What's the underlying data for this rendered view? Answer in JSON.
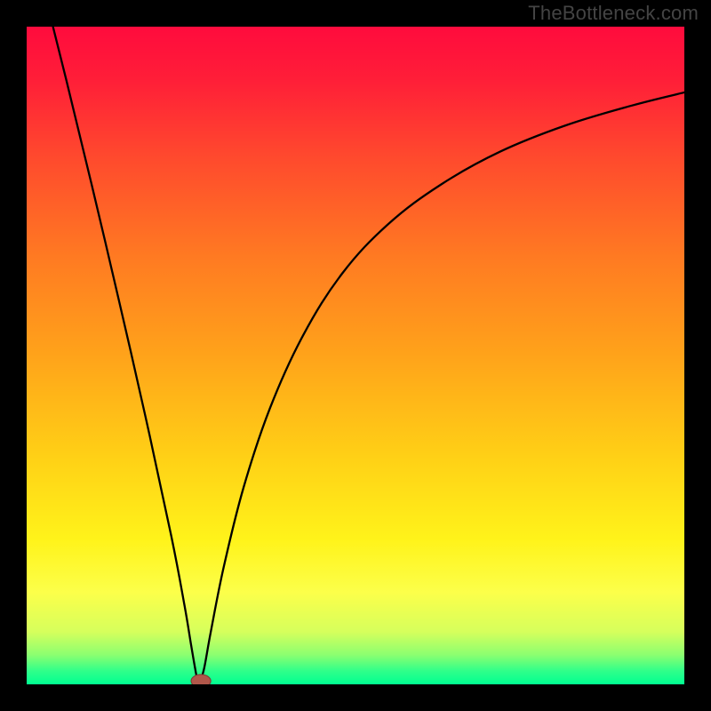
{
  "watermark": "TheBottleneck.com",
  "colors": {
    "page_bg": "#000000",
    "watermark_color": "#444444",
    "gradient_stops": [
      {
        "offset": 0.0,
        "color": "#ff0b3d"
      },
      {
        "offset": 0.08,
        "color": "#ff1e38"
      },
      {
        "offset": 0.2,
        "color": "#ff4a2d"
      },
      {
        "offset": 0.35,
        "color": "#ff7a22"
      },
      {
        "offset": 0.5,
        "color": "#ffa31a"
      },
      {
        "offset": 0.65,
        "color": "#ffcf16"
      },
      {
        "offset": 0.78,
        "color": "#fff31a"
      },
      {
        "offset": 0.86,
        "color": "#fcff4a"
      },
      {
        "offset": 0.92,
        "color": "#d6ff5c"
      },
      {
        "offset": 0.955,
        "color": "#8cff70"
      },
      {
        "offset": 0.98,
        "color": "#2fff8a"
      },
      {
        "offset": 1.0,
        "color": "#00ff91"
      }
    ],
    "curve_stroke": "#000000",
    "marker_fill": "#b0574a",
    "marker_stroke": "#7a3a33"
  },
  "chart_data": {
    "type": "line",
    "title": "",
    "xlabel": "",
    "ylabel": "",
    "xlim": [
      0,
      100
    ],
    "ylim": [
      0,
      100
    ],
    "grid": false,
    "minimum_x": 26,
    "marker": {
      "x": 26.5,
      "y": 0.5,
      "rx": 1.5,
      "ry": 1.0
    },
    "curve": [
      {
        "x": 4.0,
        "y": 100.0
      },
      {
        "x": 6.0,
        "y": 92.0
      },
      {
        "x": 10.0,
        "y": 75.5
      },
      {
        "x": 14.0,
        "y": 58.5
      },
      {
        "x": 18.0,
        "y": 41.0
      },
      {
        "x": 22.0,
        "y": 22.5
      },
      {
        "x": 24.0,
        "y": 12.0
      },
      {
        "x": 25.0,
        "y": 6.0
      },
      {
        "x": 25.6,
        "y": 2.5
      },
      {
        "x": 26.0,
        "y": 0.6
      },
      {
        "x": 26.4,
        "y": 0.6
      },
      {
        "x": 27.0,
        "y": 2.5
      },
      {
        "x": 28.0,
        "y": 8.0
      },
      {
        "x": 30.0,
        "y": 18.0
      },
      {
        "x": 33.0,
        "y": 30.0
      },
      {
        "x": 37.0,
        "y": 42.0
      },
      {
        "x": 42.0,
        "y": 53.0
      },
      {
        "x": 48.0,
        "y": 62.5
      },
      {
        "x": 55.0,
        "y": 70.0
      },
      {
        "x": 63.0,
        "y": 76.0
      },
      {
        "x": 72.0,
        "y": 81.0
      },
      {
        "x": 82.0,
        "y": 85.0
      },
      {
        "x": 92.0,
        "y": 88.0
      },
      {
        "x": 100.0,
        "y": 90.0
      }
    ]
  }
}
